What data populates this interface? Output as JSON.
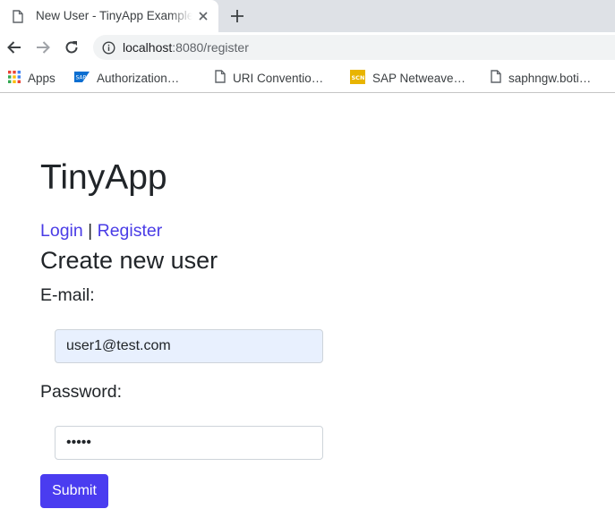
{
  "browser": {
    "tab_title": "New User - TinyApp Example",
    "url_host": "localhost",
    "url_rest": ":8080/register",
    "bookmarks": [
      {
        "label": "Apps",
        "icon": "apps-grid-icon"
      },
      {
        "label": "Authorization…",
        "icon": "sap-logo-icon"
      },
      {
        "label": "URI Conventio…",
        "icon": "page-icon"
      },
      {
        "label": "SAP Netweave…",
        "icon": "scn-logo-icon"
      },
      {
        "label": "saphngw.boti…",
        "icon": "page-icon"
      }
    ]
  },
  "page": {
    "app_title": "TinyApp",
    "nav": {
      "login": "Login",
      "separator": " | ",
      "register": "Register"
    },
    "form_heading": "Create new user",
    "email_label": "E-mail:",
    "email_value": "user1@test.com",
    "password_label": "Password:",
    "password_value": "12345",
    "submit_label": "Submit"
  },
  "colors": {
    "link": "#4a3ce6",
    "button": "#4a3cf0",
    "autofill_bg": "#e8f0fe"
  }
}
